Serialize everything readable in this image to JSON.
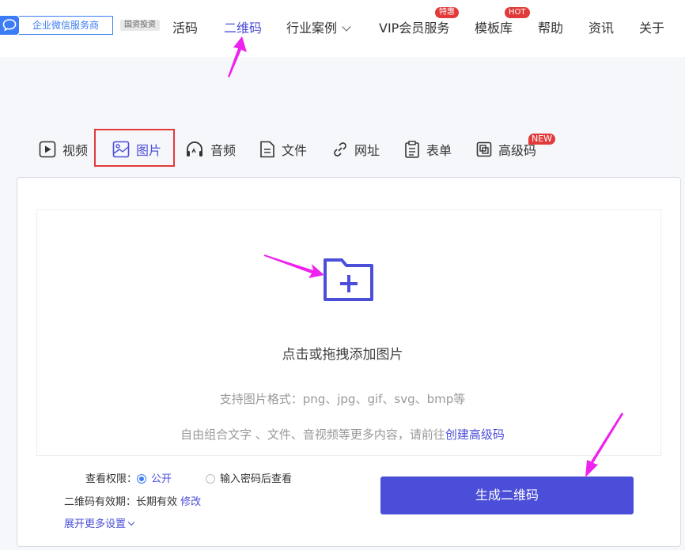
{
  "header": {
    "brand_label": "企业微信服务商",
    "gov_badge": "国资投资",
    "nav": [
      {
        "label": "活码"
      },
      {
        "label": "二维码"
      },
      {
        "label": "行业案例"
      },
      {
        "label": "VIP会员服务",
        "tag": "特惠"
      },
      {
        "label": "模板库",
        "tag": "HOT"
      },
      {
        "label": "帮助"
      },
      {
        "label": "资讯"
      },
      {
        "label": "关于"
      }
    ],
    "active_nav": "二维码"
  },
  "tabs": {
    "items": [
      {
        "label": "视频",
        "icon": "play-icon"
      },
      {
        "label": "图片",
        "icon": "image-icon"
      },
      {
        "label": "音频",
        "icon": "headphones-icon"
      },
      {
        "label": "文件",
        "icon": "file-icon"
      },
      {
        "label": "网址",
        "icon": "link-icon"
      },
      {
        "label": "表单",
        "icon": "clipboard-icon"
      },
      {
        "label": "高级码",
        "icon": "layers-icon",
        "tag": "NEW"
      }
    ],
    "active": "图片"
  },
  "upload": {
    "title": "点击或拖拽添加图片",
    "formats": "支持图片格式：png、jpg、gif、svg、bmp等",
    "hint_prefix": "自由组合文字 、文件、音视频等更多内容，请前往",
    "hint_link": "创建高级码"
  },
  "settings": {
    "permission_label": "查看权限：",
    "public_label": "公开",
    "password_label": "输入密码后查看",
    "validity_label": "二维码有效期：长期有效",
    "modify_label": "修改",
    "more_label": "展开更多设置"
  },
  "generate_button": "生成二维码",
  "colors": {
    "accent": "#4b4ed8",
    "brand_blue": "#3c7cf6",
    "tag_red": "#e23a3a",
    "annotation_magenta": "#ee22ee"
  }
}
